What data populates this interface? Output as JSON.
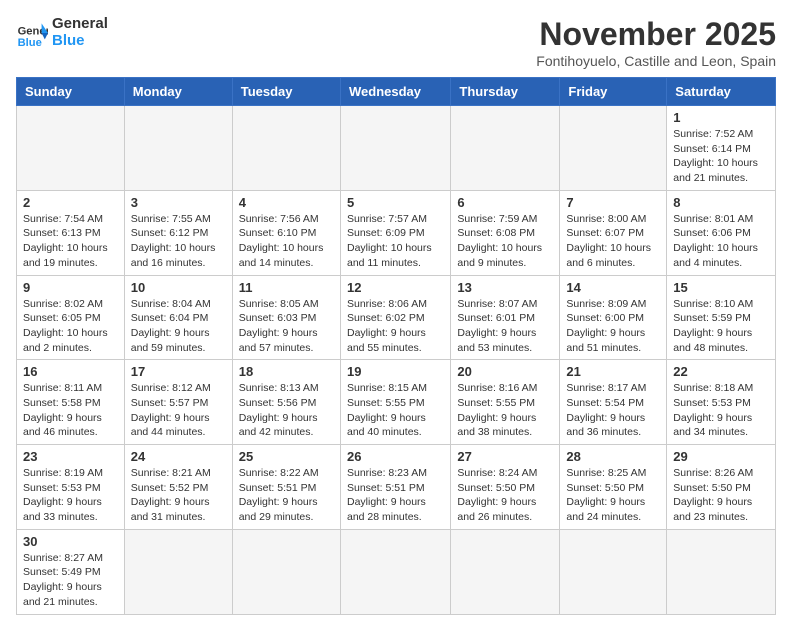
{
  "header": {
    "logo_general": "General",
    "logo_blue": "Blue",
    "month_year": "November 2025",
    "location": "Fontihoyuelo, Castille and Leon, Spain"
  },
  "days_of_week": [
    "Sunday",
    "Monday",
    "Tuesday",
    "Wednesday",
    "Thursday",
    "Friday",
    "Saturday"
  ],
  "weeks": [
    [
      {
        "day": "",
        "info": ""
      },
      {
        "day": "",
        "info": ""
      },
      {
        "day": "",
        "info": ""
      },
      {
        "day": "",
        "info": ""
      },
      {
        "day": "",
        "info": ""
      },
      {
        "day": "",
        "info": ""
      },
      {
        "day": "1",
        "info": "Sunrise: 7:52 AM\nSunset: 6:14 PM\nDaylight: 10 hours and 21 minutes."
      }
    ],
    [
      {
        "day": "2",
        "info": "Sunrise: 7:54 AM\nSunset: 6:13 PM\nDaylight: 10 hours and 19 minutes."
      },
      {
        "day": "3",
        "info": "Sunrise: 7:55 AM\nSunset: 6:12 PM\nDaylight: 10 hours and 16 minutes."
      },
      {
        "day": "4",
        "info": "Sunrise: 7:56 AM\nSunset: 6:10 PM\nDaylight: 10 hours and 14 minutes."
      },
      {
        "day": "5",
        "info": "Sunrise: 7:57 AM\nSunset: 6:09 PM\nDaylight: 10 hours and 11 minutes."
      },
      {
        "day": "6",
        "info": "Sunrise: 7:59 AM\nSunset: 6:08 PM\nDaylight: 10 hours and 9 minutes."
      },
      {
        "day": "7",
        "info": "Sunrise: 8:00 AM\nSunset: 6:07 PM\nDaylight: 10 hours and 6 minutes."
      },
      {
        "day": "8",
        "info": "Sunrise: 8:01 AM\nSunset: 6:06 PM\nDaylight: 10 hours and 4 minutes."
      }
    ],
    [
      {
        "day": "9",
        "info": "Sunrise: 8:02 AM\nSunset: 6:05 PM\nDaylight: 10 hours and 2 minutes."
      },
      {
        "day": "10",
        "info": "Sunrise: 8:04 AM\nSunset: 6:04 PM\nDaylight: 9 hours and 59 minutes."
      },
      {
        "day": "11",
        "info": "Sunrise: 8:05 AM\nSunset: 6:03 PM\nDaylight: 9 hours and 57 minutes."
      },
      {
        "day": "12",
        "info": "Sunrise: 8:06 AM\nSunset: 6:02 PM\nDaylight: 9 hours and 55 minutes."
      },
      {
        "day": "13",
        "info": "Sunrise: 8:07 AM\nSunset: 6:01 PM\nDaylight: 9 hours and 53 minutes."
      },
      {
        "day": "14",
        "info": "Sunrise: 8:09 AM\nSunset: 6:00 PM\nDaylight: 9 hours and 51 minutes."
      },
      {
        "day": "15",
        "info": "Sunrise: 8:10 AM\nSunset: 5:59 PM\nDaylight: 9 hours and 48 minutes."
      }
    ],
    [
      {
        "day": "16",
        "info": "Sunrise: 8:11 AM\nSunset: 5:58 PM\nDaylight: 9 hours and 46 minutes."
      },
      {
        "day": "17",
        "info": "Sunrise: 8:12 AM\nSunset: 5:57 PM\nDaylight: 9 hours and 44 minutes."
      },
      {
        "day": "18",
        "info": "Sunrise: 8:13 AM\nSunset: 5:56 PM\nDaylight: 9 hours and 42 minutes."
      },
      {
        "day": "19",
        "info": "Sunrise: 8:15 AM\nSunset: 5:55 PM\nDaylight: 9 hours and 40 minutes."
      },
      {
        "day": "20",
        "info": "Sunrise: 8:16 AM\nSunset: 5:55 PM\nDaylight: 9 hours and 38 minutes."
      },
      {
        "day": "21",
        "info": "Sunrise: 8:17 AM\nSunset: 5:54 PM\nDaylight: 9 hours and 36 minutes."
      },
      {
        "day": "22",
        "info": "Sunrise: 8:18 AM\nSunset: 5:53 PM\nDaylight: 9 hours and 34 minutes."
      }
    ],
    [
      {
        "day": "23",
        "info": "Sunrise: 8:19 AM\nSunset: 5:53 PM\nDaylight: 9 hours and 33 minutes."
      },
      {
        "day": "24",
        "info": "Sunrise: 8:21 AM\nSunset: 5:52 PM\nDaylight: 9 hours and 31 minutes."
      },
      {
        "day": "25",
        "info": "Sunrise: 8:22 AM\nSunset: 5:51 PM\nDaylight: 9 hours and 29 minutes."
      },
      {
        "day": "26",
        "info": "Sunrise: 8:23 AM\nSunset: 5:51 PM\nDaylight: 9 hours and 28 minutes."
      },
      {
        "day": "27",
        "info": "Sunrise: 8:24 AM\nSunset: 5:50 PM\nDaylight: 9 hours and 26 minutes."
      },
      {
        "day": "28",
        "info": "Sunrise: 8:25 AM\nSunset: 5:50 PM\nDaylight: 9 hours and 24 minutes."
      },
      {
        "day": "29",
        "info": "Sunrise: 8:26 AM\nSunset: 5:50 PM\nDaylight: 9 hours and 23 minutes."
      }
    ],
    [
      {
        "day": "30",
        "info": "Sunrise: 8:27 AM\nSunset: 5:49 PM\nDaylight: 9 hours and 21 minutes."
      },
      {
        "day": "",
        "info": ""
      },
      {
        "day": "",
        "info": ""
      },
      {
        "day": "",
        "info": ""
      },
      {
        "day": "",
        "info": ""
      },
      {
        "day": "",
        "info": ""
      },
      {
        "day": "",
        "info": ""
      }
    ]
  ]
}
